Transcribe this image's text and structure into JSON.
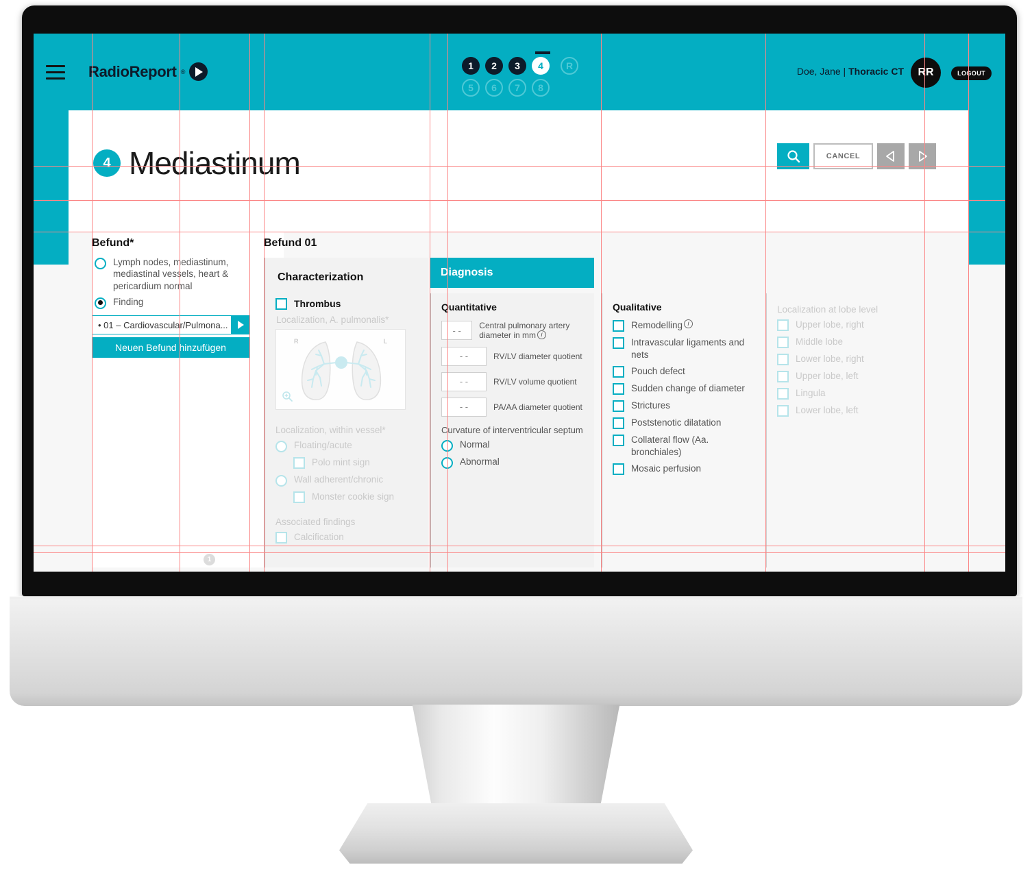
{
  "header": {
    "brand_name": "RadioReport",
    "brand_reg": "®",
    "menu_icon": "hamburger-icon",
    "steps_done": [
      "1",
      "2",
      "3"
    ],
    "step_current": "4",
    "steps_todo": [
      "5",
      "6",
      "7",
      "8"
    ],
    "step_r": "R",
    "user": "Doe, Jane | ",
    "user_exam": "Thoracic CT",
    "avatar_initials": "RR",
    "logout_label": "LOGOUT"
  },
  "title": {
    "badge": "4",
    "name": "Mediastinum",
    "search_icon": "search-icon",
    "cancel_label": "CANCEL",
    "prev_icon": "triangle-left-icon",
    "next_icon": "triangle-right-icon"
  },
  "befund": {
    "heading": "Befund*",
    "option_normal": "Lymph nodes, mediastinum, mediastinal vessels, heart & pericardium normal",
    "option_finding": "Finding",
    "selected": "finding",
    "dropdown_value": "• 01 – Cardiovascular/Pulmona...",
    "dropdown_arrow_icon": "triangle-right-icon",
    "add_button": "Neuen Befund hinzufügen",
    "page_number": "1"
  },
  "finding": {
    "heading": "Befund 01"
  },
  "characterization": {
    "heading": "Characterization",
    "thrombus_label": "Thrombus",
    "loc_pulmonalis_label": "Localization, A. pulmonalis*",
    "lung_right_marker": "R",
    "lung_left_marker": "L",
    "zoom_icon": "magnifier-plus-icon",
    "loc_vessel_label": "Localization, within vessel*",
    "vessel_options": [
      "Floating/acute",
      "Wall adherent/chronic"
    ],
    "floating_sub": "Polo mint sign",
    "wall_sub": "Monster cookie sign",
    "associated_label": "Associated findings",
    "associated_items": [
      "Calcification"
    ]
  },
  "diagnosis": {
    "tab_label": "Diagnosis",
    "quantitative_heading": "Quantitative",
    "quantitative_rows": [
      {
        "value": "- -",
        "label": "Central pulmonary artery diameter in mm",
        "info": true
      },
      {
        "value": "- -",
        "label": "RV/LV diameter quotient",
        "info": false
      },
      {
        "value": "- -",
        "label": "RV/LV volume quotient",
        "info": false
      },
      {
        "value": "- -",
        "label": "PA/AA diameter quotient",
        "info": false
      }
    ],
    "curvature_label": "Curvature of interventricular septum",
    "curvature_options": [
      "Normal",
      "Abnormal"
    ]
  },
  "qualitative": {
    "heading": "Qualitative",
    "items": [
      {
        "label": "Remodelling",
        "info": true
      },
      {
        "label": "Intravascular ligaments and nets",
        "info": false
      },
      {
        "label": "Pouch defect",
        "info": false
      },
      {
        "label": "Sudden change of diameter",
        "info": false
      },
      {
        "label": "Strictures",
        "info": false
      },
      {
        "label": "Poststenotic dilatation",
        "info": false
      },
      {
        "label": "Collateral flow (Aa. bronchiales)",
        "info": false
      },
      {
        "label": "Mosaic perfusion",
        "info": false
      }
    ]
  },
  "localization": {
    "heading": "Localization at lobe level",
    "items": [
      "Upper lobe, right",
      "Middle lobe",
      "Lower lobe, right",
      "Upper lobe, left",
      "Lingula",
      "Lower lobe, left"
    ]
  },
  "colors": {
    "accent": "#04aec2",
    "dark": "#0d1b2a",
    "guide": "#fb8686",
    "panel": "#f2f2f2"
  }
}
